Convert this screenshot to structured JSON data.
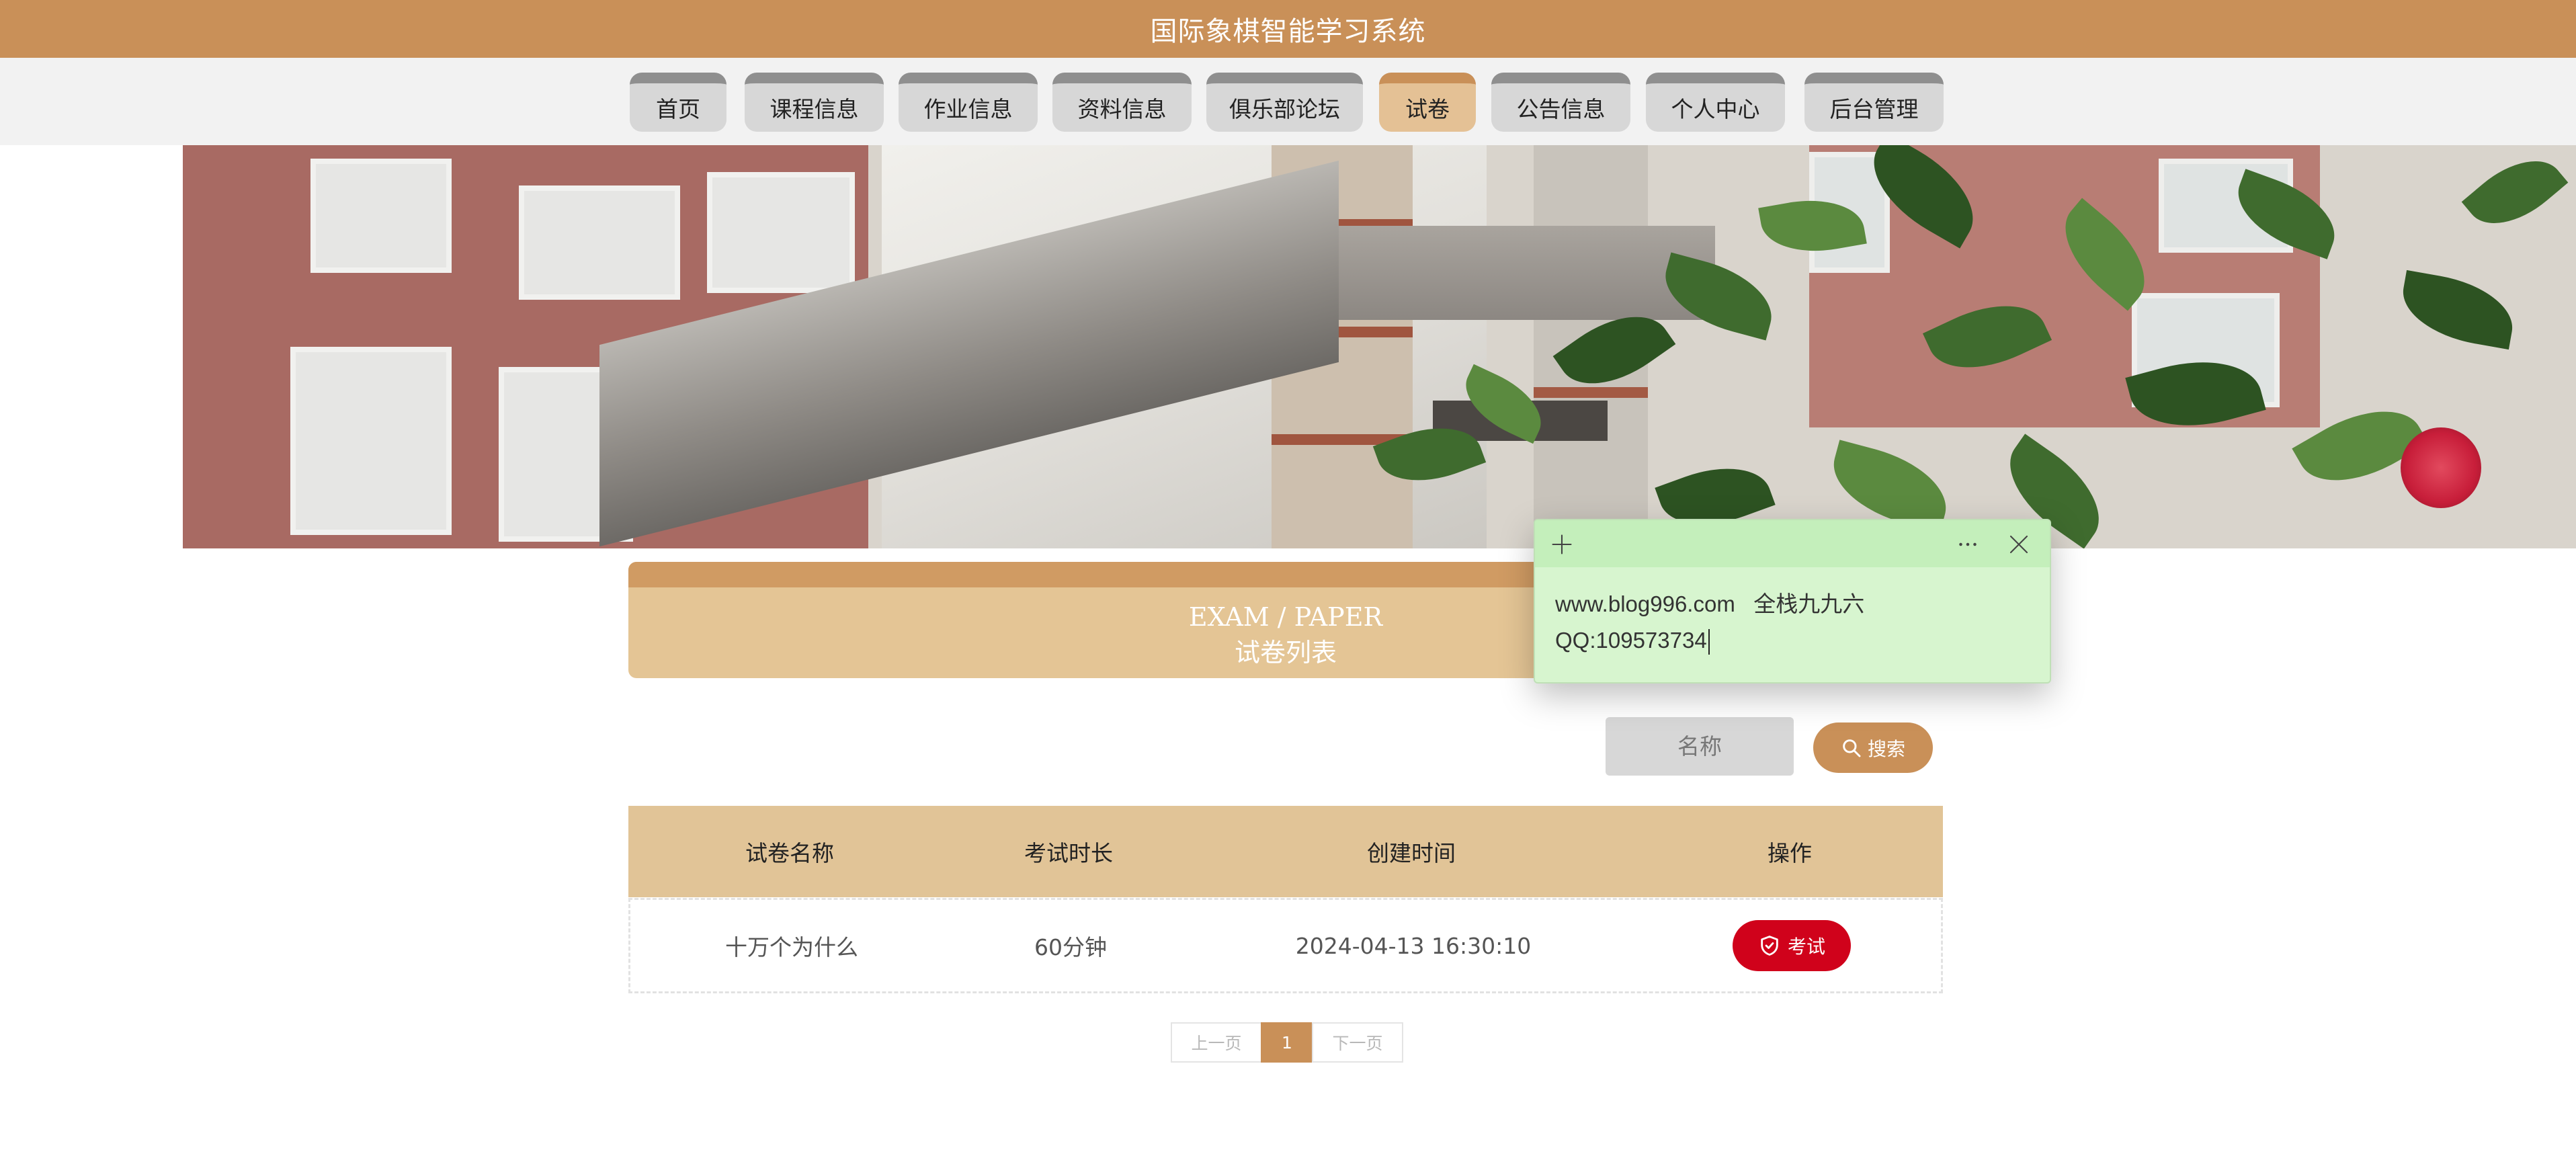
{
  "header": {
    "title": "国际象棋智能学习系统"
  },
  "nav": {
    "items": [
      {
        "label": "首页"
      },
      {
        "label": "课程信息"
      },
      {
        "label": "作业信息"
      },
      {
        "label": "资料信息"
      },
      {
        "label": "俱乐部论坛"
      },
      {
        "label": "试卷",
        "active": true
      },
      {
        "label": "公告信息"
      },
      {
        "label": "个人中心"
      },
      {
        "label": "后台管理"
      }
    ]
  },
  "section": {
    "title_en": "EXAM / PAPER",
    "title_zh": "试卷列表"
  },
  "search": {
    "placeholder": "名称",
    "button_label": "搜索",
    "icon": "search-icon"
  },
  "table": {
    "columns": [
      "试卷名称",
      "考试时长",
      "创建时间",
      "操作"
    ],
    "rows": [
      {
        "name": "十万个为什么",
        "duration": "60分钟",
        "created": "2024-04-13 16:30:10",
        "action": "考试"
      }
    ]
  },
  "pagination": {
    "prev": "上一页",
    "current": "1",
    "next": "下一页"
  },
  "note": {
    "line1": "www.blog996.com   全栈九九六",
    "line2": "QQ:109573734"
  },
  "colors": {
    "brand": "#c99058",
    "header_bg": "#e4c595",
    "table_head": "#e1c497",
    "danger": "#d0021b",
    "note_bg": "#d7f5cf"
  }
}
